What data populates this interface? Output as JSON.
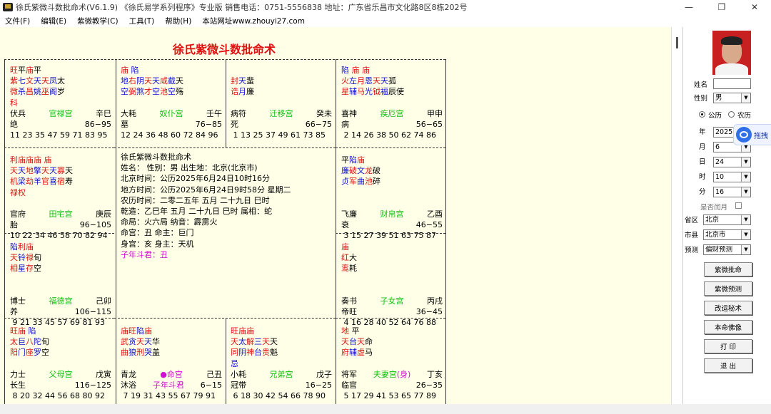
{
  "window": {
    "title": "徐氏紫微斗数批命术(V6.1.9)  《徐氏易学系列程序》专业版  销售电话：0751-5556838  地址：广东省乐昌市文化路8区8栋202号",
    "minimize": "—",
    "maximize": "❐",
    "close": "✕"
  },
  "menu": [
    "文件(F)",
    "编辑(E)",
    "紫微教学(C)",
    "工具(T)",
    "帮助(H)",
    "本站网址www.zhouyi27.com"
  ],
  "chart": {
    "title": "徐氏紫微斗数批命术",
    "palaces": [
      {
        "id": "si",
        "brightness": [
          [
            "旺",
            "red"
          ],
          [
            "平",
            "black"
          ],
          [
            "庙",
            "red"
          ],
          [
            "平",
            "black"
          ]
        ],
        "stars1": [
          [
            "紫",
            "red"
          ],
          [
            "七",
            "blue"
          ],
          [
            "文",
            "red"
          ],
          [
            "天",
            "blue"
          ],
          [
            "天",
            "red"
          ],
          [
            "凤",
            "blue"
          ],
          [
            "太",
            "black"
          ]
        ],
        "stars2": [
          [
            "微",
            "red"
          ],
          [
            "杀",
            "blue"
          ],
          [
            "昌",
            "red"
          ],
          [
            "姚",
            "blue"
          ],
          [
            "巫",
            "red"
          ],
          [
            "阁",
            "blue"
          ],
          [
            "岁",
            "black"
          ]
        ],
        "stars3": [
          [
            "科",
            "red"
          ]
        ],
        "god": "伏兵",
        "palace": "官禄宫",
        "ganzhi": "辛巳",
        "stage": "绝",
        "range": "86−95",
        "nums": "11 23 35 47 59 71 83 95"
      },
      {
        "id": "wu",
        "brightness": [
          [
            "庙",
            "red"
          ],
          [
            "      ",
            "black"
          ],
          [
            "陷",
            "blue"
          ]
        ],
        "stars1": [
          [
            "地",
            "blue"
          ],
          [
            "右",
            "red"
          ],
          [
            "阴",
            "blue"
          ],
          [
            "天",
            "red"
          ],
          [
            "天",
            "blue"
          ],
          [
            "咸",
            "red"
          ],
          [
            "截",
            "blue"
          ],
          [
            "天",
            "black"
          ]
        ],
        "stars2": [
          [
            "空",
            "blue"
          ],
          [
            "弼",
            "red"
          ],
          [
            "煞",
            "blue"
          ],
          [
            "才",
            "red"
          ],
          [
            "空",
            "blue"
          ],
          [
            "池",
            "red"
          ],
          [
            "空",
            "blue"
          ],
          [
            "殇",
            "black"
          ]
        ],
        "stars3": [],
        "god": "大耗",
        "palace": "奴仆宫",
        "ganzhi": "壬午",
        "stage": "墓",
        "range": "76−85",
        "nums": "12 24 36 48 60 72 84 96"
      },
      {
        "id": "wei",
        "brightness": [],
        "stars1": [
          [
            "封",
            "red"
          ],
          [
            "天",
            "blue"
          ],
          [
            "蜚",
            "black"
          ]
        ],
        "stars2": [
          [
            "诰",
            "red"
          ],
          [
            "月",
            "blue"
          ],
          [
            "廉",
            "black"
          ]
        ],
        "stars3": [],
        "god": "病符",
        "palace": "迁移宫",
        "ganzhi": "癸未",
        "stage": "死",
        "range": "66−75",
        "nums": " 1 13 25 37 49 61 73 85"
      },
      {
        "id": "shen",
        "brightness": [
          [
            "陷",
            "blue"
          ],
          [
            "  ",
            "black"
          ],
          [
            "庙",
            "red"
          ],
          [
            "    ",
            "black"
          ],
          [
            "庙",
            "red"
          ]
        ],
        "stars1": [
          [
            "火",
            "red"
          ],
          [
            "左",
            "blue"
          ],
          [
            "月",
            "red"
          ],
          [
            "恩",
            "blue"
          ],
          [
            "天",
            "red"
          ],
          [
            "天",
            "blue"
          ],
          [
            "孤",
            "black"
          ]
        ],
        "stars2": [
          [
            "星",
            "red"
          ],
          [
            "辅",
            "blue"
          ],
          [
            "马",
            "red"
          ],
          [
            "光",
            "blue"
          ],
          [
            "钺",
            "red"
          ],
          [
            "福",
            "blue"
          ],
          [
            "辰",
            "black"
          ],
          [
            "使",
            "black"
          ]
        ],
        "stars3": [],
        "god": "喜神",
        "palace": "疾厄宫",
        "ganzhi": "甲申",
        "stage": "病",
        "range": "56−65",
        "nums": " 2 14 26 38 50 62 74 86"
      },
      {
        "id": "chen",
        "brightness": [
          [
            "利",
            "red"
          ],
          [
            "庙",
            "red"
          ],
          [
            "庙",
            "red"
          ],
          [
            "庙",
            "red"
          ],
          [
            "  ",
            "black"
          ],
          [
            "庙",
            "red"
          ]
        ],
        "stars1": [
          [
            "天",
            "red"
          ],
          [
            "天",
            "blue"
          ],
          [
            "地",
            "red"
          ],
          [
            "擎",
            "blue"
          ],
          [
            "天",
            "red"
          ],
          [
            "天",
            "blue"
          ],
          [
            "寡",
            "red"
          ],
          [
            "天",
            "black"
          ]
        ],
        "stars2": [
          [
            "机",
            "red"
          ],
          [
            "梁",
            "blue"
          ],
          [
            "劫",
            "red"
          ],
          [
            "羊",
            "blue"
          ],
          [
            "官",
            "red"
          ],
          [
            "喜",
            "blue"
          ],
          [
            "宿",
            "red"
          ],
          [
            "寿",
            "black"
          ]
        ],
        "stars3": [
          [
            "禄",
            "red"
          ],
          [
            "权",
            "red"
          ]
        ],
        "god": "官府",
        "palace": "田宅宫",
        "ganzhi": "庚辰",
        "stage": "胎",
        "range": "96−105",
        "nums": "10 22 34 46 58 70 82 94"
      },
      {
        "id": "you",
        "brightness": [
          [
            "平",
            "black"
          ],
          [
            "陷",
            "blue"
          ],
          [
            "庙",
            "red"
          ]
        ],
        "stars1": [
          [
            "廉",
            "blue"
          ],
          [
            "破",
            "red"
          ],
          [
            "文",
            "blue"
          ],
          [
            "龙",
            "red"
          ],
          [
            "破",
            "black"
          ]
        ],
        "stars2": [
          [
            "贞",
            "blue"
          ],
          [
            "军",
            "red"
          ],
          [
            "曲",
            "blue"
          ],
          [
            "池",
            "red"
          ],
          [
            "碎",
            "black"
          ]
        ],
        "stars3": [],
        "god": "飞廉",
        "palace": "财帛宫",
        "ganzhi": "乙酉",
        "stage": "衰",
        "range": "46−55",
        "nums": " 3 15 27 39 51 63 75 87"
      },
      {
        "id": "mao",
        "brightness": [
          [
            "陷",
            "blue"
          ],
          [
            "利",
            "red"
          ],
          [
            "庙",
            "red"
          ]
        ],
        "stars1": [
          [
            "天",
            "red"
          ],
          [
            "铃",
            "blue"
          ],
          [
            "禄",
            "red"
          ],
          [
            "旬",
            "black"
          ]
        ],
        "stars2": [
          [
            "相",
            "red"
          ],
          [
            "星",
            "blue"
          ],
          [
            "存",
            "red"
          ],
          [
            "空",
            "black"
          ]
        ],
        "stars3": [],
        "god": "博士",
        "palace": "福德宫",
        "ganzhi": "己卯",
        "stage": "养",
        "range": "106−115",
        "nums": " 9 21 33 45 57 69 81 93"
      },
      {
        "id": "xu",
        "brightness": [
          [
            "庙",
            "red"
          ]
        ],
        "stars1": [
          [
            "红",
            "red"
          ],
          [
            "大",
            "black"
          ]
        ],
        "stars2": [
          [
            "鸾",
            "red"
          ],
          [
            "耗",
            "black"
          ]
        ],
        "stars3": [],
        "god": "奏书",
        "palace": "子女宫",
        "ganzhi": "丙戌",
        "stage": "帝旺",
        "range": "36−45",
        "nums": " 4 16 28 40 52 64 76 88"
      },
      {
        "id": "yin",
        "brightness": [
          [
            "旺",
            "red"
          ],
          [
            "庙",
            "red"
          ],
          [
            "  ",
            "black"
          ],
          [
            "陷",
            "blue"
          ]
        ],
        "stars1": [
          [
            "太",
            "red"
          ],
          [
            "巨",
            "blue"
          ],
          [
            "八",
            "red"
          ],
          [
            "陀",
            "blue"
          ],
          [
            "旬",
            "black"
          ]
        ],
        "stars2": [
          [
            "阳",
            "red"
          ],
          [
            "门",
            "blue"
          ],
          [
            "座",
            "red"
          ],
          [
            "罗",
            "blue"
          ],
          [
            "空",
            "black"
          ]
        ],
        "stars3": [],
        "god": "力士",
        "palace": "父母宫",
        "ganzhi": "戊寅",
        "stage": "长生",
        "range": "116−125",
        "nums": " 8 20 32 44 56 68 80 92"
      },
      {
        "id": "chou",
        "brightness": [
          [
            "庙",
            "red"
          ],
          [
            "旺",
            "red"
          ],
          [
            "陷",
            "blue"
          ],
          [
            "庙",
            "red"
          ]
        ],
        "stars1": [
          [
            "武",
            "red"
          ],
          [
            "贪",
            "blue"
          ],
          [
            "天",
            "red"
          ],
          [
            "天",
            "blue"
          ],
          [
            "华",
            "black"
          ]
        ],
        "stars2": [
          [
            "曲",
            "red"
          ],
          [
            "狼",
            "blue"
          ],
          [
            "刑",
            "red"
          ],
          [
            "哭",
            "blue"
          ],
          [
            "盖",
            "black"
          ]
        ],
        "stars3": [],
        "god": "青龙",
        "palace": "●命宫",
        "ganzhi": "己丑",
        "stage": "沐浴",
        "stage_extra": "子年斗君",
        "range": "6−15",
        "nums": " 7 19 31 43 55 67 79 91"
      },
      {
        "id": "zi",
        "brightness": [
          [
            "旺",
            "red"
          ],
          [
            "庙",
            "red"
          ],
          [
            "庙",
            "red"
          ]
        ],
        "stars1": [
          [
            "天",
            "red"
          ],
          [
            "太",
            "blue"
          ],
          [
            "解",
            "red"
          ],
          [
            "三",
            "blue"
          ],
          [
            "天",
            "red"
          ],
          [
            "天",
            "black"
          ]
        ],
        "stars2": [
          [
            "同",
            "red"
          ],
          [
            "阴",
            "blue"
          ],
          [
            "神",
            "red"
          ],
          [
            "台",
            "blue"
          ],
          [
            "贵",
            "red"
          ],
          [
            "魁",
            "black"
          ]
        ],
        "stars3": [
          [
            "  忌",
            "blue"
          ]
        ],
        "god": "小耗",
        "palace": "兄弟宫",
        "ganzhi": "戊子",
        "stage": "冠带",
        "range": "16−25",
        "nums": " 6 18 30 42 54 66 78 90"
      },
      {
        "id": "hai",
        "brightness": [
          [
            "地",
            "red"
          ],
          [
            "    ",
            "black"
          ],
          [
            "平",
            "black"
          ]
        ],
        "stars1": [
          [
            "天",
            "red"
          ],
          [
            "台",
            "blue"
          ],
          [
            "天",
            "red"
          ],
          [
            "命",
            "black"
          ]
        ],
        "stars2": [
          [
            "府",
            "red"
          ],
          [
            "辅",
            "blue"
          ],
          [
            "虚",
            "red"
          ],
          [
            "马",
            "black"
          ]
        ],
        "stars3": [],
        "god": "将军",
        "palace": "夫妻宫(身)",
        "ganzhi": "丁亥",
        "stage": "临官",
        "range": "26−35",
        "nums": " 5 17 29 41 53 65 77 89"
      }
    ],
    "center": [
      "徐氏紫微斗数批命术",
      "姓名：  性别：男   出生地：北京(北京市)",
      "北京时间：公历2025年6月24日10时16分",
      "地方时间：公历2025年6月24日9时58分  星期二",
      "农历时间：二零二五年  五月  二十九日  巳时",
      "乾造：乙巳年  五月  二十九日  巳时  属相：蛇",
      "命局：火六局     纳音：霹雳火",
      "命宫：丑   命主：巨门",
      "身宫：亥   身主：天机"
    ],
    "center_highlight": "子年斗君：丑"
  },
  "panel": {
    "name_label": "姓名",
    "gender_label": "性别",
    "gender_value": "男",
    "calendar_solar": "公历",
    "calendar_lunar": "农历",
    "year_label": "年",
    "year_value": "2025",
    "month_label": "月",
    "month_value": "6",
    "day_label": "日",
    "day_value": "24",
    "hour_label": "时",
    "hour_value": "10",
    "minute_label": "分",
    "minute_value": "16",
    "leap_label": "是否闰月",
    "province_label": "省区",
    "province_value": "北京",
    "city_label": "市县",
    "city_value": "北京市",
    "predict_label": "预测",
    "predict_value": "偏财预测",
    "buttons": [
      "紫微批命",
      "紫微预测",
      "改运秘术",
      "本命佛像",
      "打  印",
      "退  出"
    ],
    "float_text": "拖拽"
  },
  "colors": {
    "red": "#e01010",
    "blue": "#1010d0",
    "green": "#10c010",
    "magenta": "#d010d0",
    "paper": "#ffffe8"
  }
}
